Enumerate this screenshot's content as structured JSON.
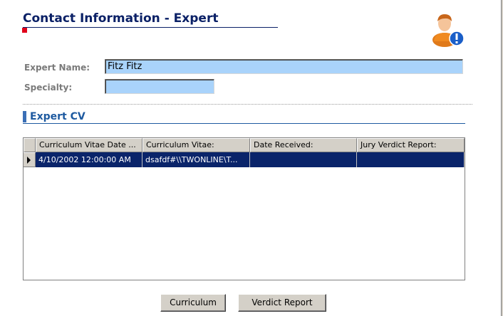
{
  "header": {
    "title": "Contact Information - Expert",
    "icon": "expert-user-icon"
  },
  "form": {
    "name_label": "Expert Name:",
    "name_value": "Fitz Fitz",
    "specialty_label": "Specialty:",
    "specialty_value": ""
  },
  "cv_section": {
    "title": "Expert CV",
    "columns": [
      "Curriculum Vitae Date ...",
      "Curriculum Vitae:",
      "Date Received:",
      "Jury Verdict Report:"
    ],
    "rows": [
      {
        "cv_date": "4/10/2002 12:00:00 AM",
        "cv": "dsafdf#\\\\TWONLINE\\T...",
        "date_received": "",
        "jury_verdict": ""
      }
    ]
  },
  "buttons": {
    "curriculum": "Curriculum",
    "verdict_report": "Verdict Report"
  },
  "colors": {
    "title": "#0a2066",
    "field_bg": "#a9d3fb",
    "selected_row": "#0a246a",
    "section_title": "#1e5aa0",
    "marker": "#e0001a"
  }
}
